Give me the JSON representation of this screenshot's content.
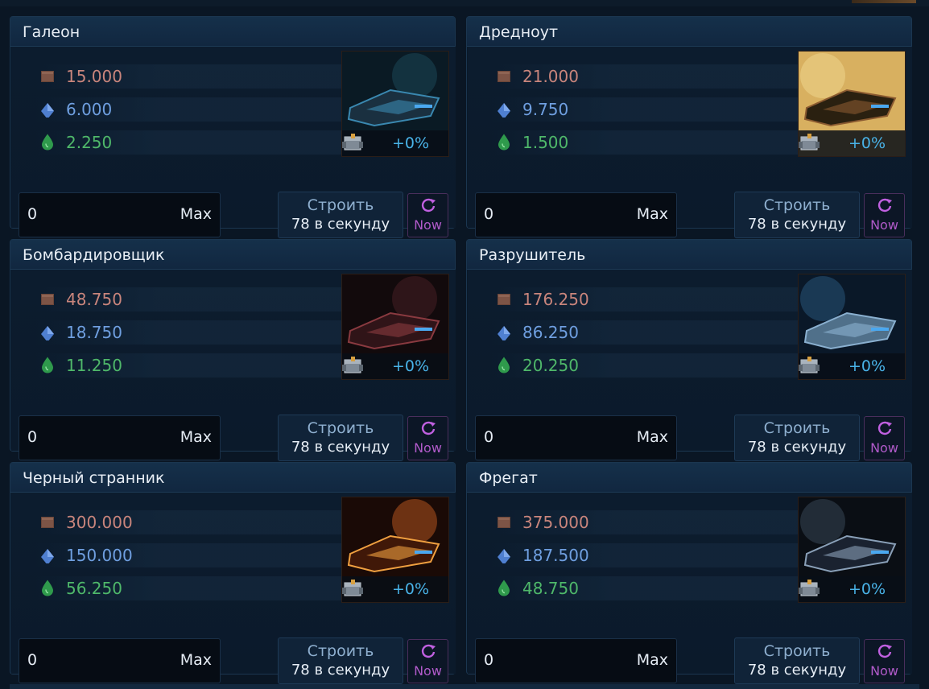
{
  "ships": [
    {
      "name": "Галеон",
      "metal": "15.000",
      "crystal": "6.000",
      "deuterium": "2.250",
      "bonus": "+0%",
      "qty": "0",
      "max_label": "Max",
      "build_label": "Строить",
      "rate_label": "78 в секунду",
      "now_label": "Now"
    },
    {
      "name": "Дредноут",
      "metal": "21.000",
      "crystal": "9.750",
      "deuterium": "1.500",
      "bonus": "+0%",
      "qty": "0",
      "max_label": "Max",
      "build_label": "Строить",
      "rate_label": "78 в секунду",
      "now_label": "Now"
    },
    {
      "name": "Бомбардировщик",
      "metal": "48.750",
      "crystal": "18.750",
      "deuterium": "11.250",
      "bonus": "+0%",
      "qty": "0",
      "max_label": "Max",
      "build_label": "Строить",
      "rate_label": "78 в секунду",
      "now_label": "Now"
    },
    {
      "name": "Разрушитель",
      "metal": "176.250",
      "crystal": "86.250",
      "deuterium": "20.250",
      "bonus": "+0%",
      "qty": "0",
      "max_label": "Max",
      "build_label": "Строить",
      "rate_label": "78 в секунду",
      "now_label": "Now"
    },
    {
      "name": "Черный странник",
      "metal": "300.000",
      "crystal": "150.000",
      "deuterium": "56.250",
      "bonus": "+0%",
      "qty": "0",
      "max_label": "Max",
      "build_label": "Строить",
      "rate_label": "78 в секунду",
      "now_label": "Now"
    },
    {
      "name": "Фрегат",
      "metal": "375.000",
      "crystal": "187.500",
      "deuterium": "48.750",
      "bonus": "+0%",
      "qty": "0",
      "max_label": "Max",
      "build_label": "Строить",
      "rate_label": "78 в секунду",
      "now_label": "Now"
    }
  ],
  "colors": {
    "metal": "#c9857c",
    "crystal": "#6f9fe0",
    "deuterium": "#4fb86a",
    "bonus": "#49b3e8",
    "now": "#b05ac9"
  },
  "icons": {
    "metal": "metal-icon",
    "crystal": "crystal-icon",
    "deuterium": "deuterium-icon",
    "bonus": "crate-icon",
    "now": "refresh-icon"
  }
}
